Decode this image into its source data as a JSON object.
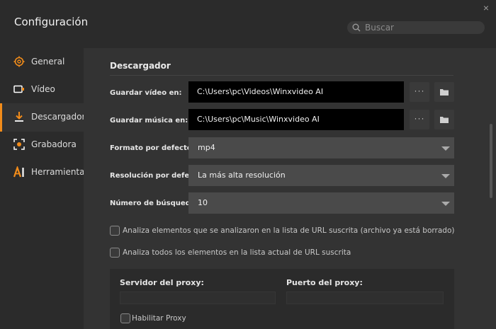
{
  "window": {
    "title": "Configuración",
    "close_label": "×"
  },
  "search": {
    "placeholder": "Buscar"
  },
  "sidebar": {
    "items": [
      {
        "label": "General",
        "icon": "gear-icon"
      },
      {
        "label": "Vídeo",
        "icon": "video-icon"
      },
      {
        "label": "Descargador",
        "icon": "download-icon",
        "active": true
      },
      {
        "label": "Grabadora",
        "icon": "record-icon"
      },
      {
        "label": "Herramientas de IA",
        "icon": "ai-icon"
      }
    ]
  },
  "downloader": {
    "section_title": "Descargador",
    "video_path_label": "Guardar vídeo en:",
    "video_path_value": "C:\\Users\\pc\\Videos\\Winxvideo AI",
    "music_path_label": "Guardar música en:",
    "music_path_value": "C:\\Users\\pc\\Music\\Winxvideo AI",
    "more_label": "···",
    "format_label": "Formato por defecto:",
    "format_value": "mp4",
    "resolution_label": "Resolución por defecto:",
    "resolution_value": "La más alta resolución",
    "searches_label": "Número de búsquedas:",
    "searches_value": "10",
    "check_reanalyze": "Analiza elementos que se analizaron en la lista de URL suscrita (archivo ya está borrado)",
    "check_analyze_all": "Analiza todos los elementos en la lista actual de URL suscrita"
  },
  "proxy": {
    "server_label": "Servidor del proxy:",
    "port_label": "Puerto del proxy:",
    "enable_label": "Habilitar Proxy"
  },
  "colors": {
    "accent": "#f28c1a",
    "background": "#333333",
    "sidebar": "#2b2b2b"
  }
}
